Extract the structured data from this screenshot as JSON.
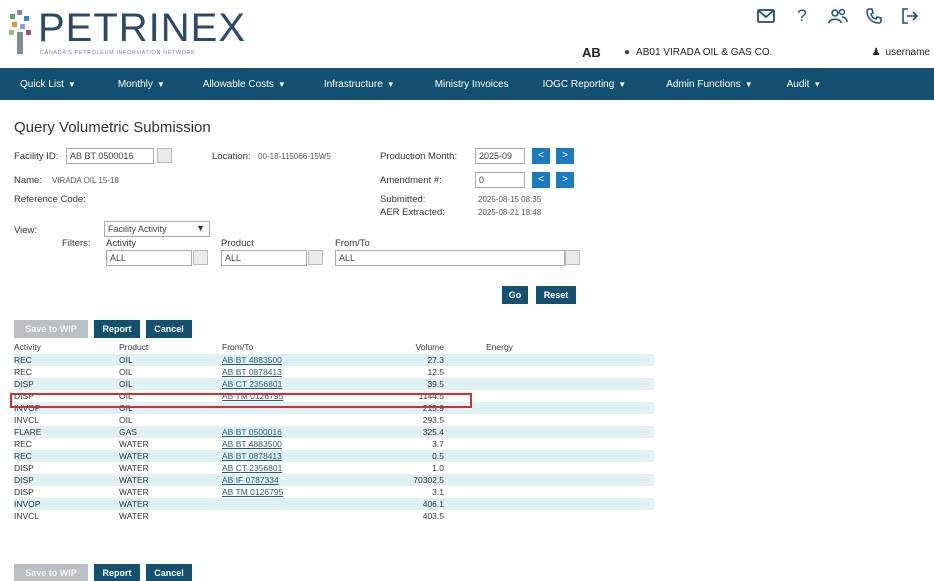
{
  "header": {
    "logo_text": "PETRINEX",
    "logo_subtitle": "CANADA'S PETROLEUM INFORMATION NETWORK",
    "province": "AB",
    "operator": "AB01 VIRADA OIL & GAS CO.",
    "username": "username"
  },
  "nav": {
    "items": [
      {
        "label": "Quick List",
        "dropdown": true
      },
      {
        "label": "Monthly",
        "dropdown": true
      },
      {
        "label": "Allowable Costs",
        "dropdown": true
      },
      {
        "label": "Infrastructure",
        "dropdown": true
      },
      {
        "label": "Ministry Invoices",
        "dropdown": false
      },
      {
        "label": "IOGC Reporting",
        "dropdown": true
      },
      {
        "label": "Admin Functions",
        "dropdown": true
      },
      {
        "label": "Audit",
        "dropdown": true
      }
    ]
  },
  "page": {
    "title": "Query Volumetric Submission",
    "facility_id_label": "Facility ID:",
    "facility_id_value": "AB BT 0500016",
    "location_label": "Location:",
    "location_value": "00-18-115066-15W5",
    "production_month_label": "Production Month:",
    "production_month_value": "2025-09",
    "name_label": "Name:",
    "name_value": "VIRADA OIL 15-18",
    "amendment_label": "Amendment #:",
    "amendment_value": "0",
    "reference_code_label": "Reference Code:",
    "submitted_label": "Submitted:",
    "submitted_value": "2025-08-15 08:35",
    "aer_extracted_label": "AER Extracted:",
    "aer_extracted_value": "2025-08-21 18:48",
    "view_label": "View:",
    "view_value": "Facility Activity",
    "filters_label": "Filters:",
    "activity_label": "Activity",
    "activity_value": "ALL",
    "product_label": "Product",
    "product_value": "ALL",
    "fromto_label": "From/To",
    "fromto_value": "ALL",
    "go_label": "Go",
    "reset_label": "Reset",
    "save_wip_label": "Save to WIP",
    "report_label": "Report",
    "cancel_label": "Cancel",
    "prev_glyph": "<",
    "next_glyph": ">"
  },
  "table": {
    "headers": {
      "activity": "Activity",
      "product": "Product",
      "fromto": "From/To",
      "volume": "Volume",
      "energy": "Energy"
    },
    "rows": [
      {
        "activity": "REC",
        "product": "OIL",
        "fromto": "AB BT 4883500",
        "volume": "27.3"
      },
      {
        "activity": "REC",
        "product": "OIL",
        "fromto": "AB BT 0878413",
        "volume": "12.5"
      },
      {
        "activity": "DISP",
        "product": "OIL",
        "fromto": "AB CT 2356801",
        "volume": "39.5"
      },
      {
        "activity": "DISP",
        "product": "OIL",
        "fromto": "AB TM 0126795",
        "volume": "1144.5"
      },
      {
        "activity": "INVOP",
        "product": "OIL",
        "fromto": "",
        "volume": "215.9"
      },
      {
        "activity": "INVCL",
        "product": "OIL",
        "fromto": "",
        "volume": "293.5"
      },
      {
        "activity": "FLARE",
        "product": "GAS",
        "fromto": "AB BT 0500016",
        "volume": "325.4"
      },
      {
        "activity": "REC",
        "product": "WATER",
        "fromto": "AB BT 4883500",
        "volume": "3.7"
      },
      {
        "activity": "REC",
        "product": "WATER",
        "fromto": "AB BT 0878413",
        "volume": "0.5"
      },
      {
        "activity": "DISP",
        "product": "WATER",
        "fromto": "AB CT 2356801",
        "volume": "1.0"
      },
      {
        "activity": "DISP",
        "product": "WATER",
        "fromto": "AB IF 0787334",
        "volume": "70302.5"
      },
      {
        "activity": "DISP",
        "product": "WATER",
        "fromto": "AB TM 0126795",
        "volume": "3.1"
      },
      {
        "activity": "INVOP",
        "product": "WATER",
        "fromto": "",
        "volume": "406.1"
      },
      {
        "activity": "INVCL",
        "product": "WATER",
        "fromto": "",
        "volume": "403.5"
      }
    ]
  },
  "colors": {
    "nav_bg": "#14506f",
    "accent_blue": "#1a7bbf",
    "row_alt": "#dff1f4",
    "highlight": "#d32f2f"
  },
  "icons": [
    "mail-icon",
    "help-icon",
    "users-icon",
    "phone-icon",
    "logout-icon",
    "location-pin-icon",
    "user-icon"
  ]
}
